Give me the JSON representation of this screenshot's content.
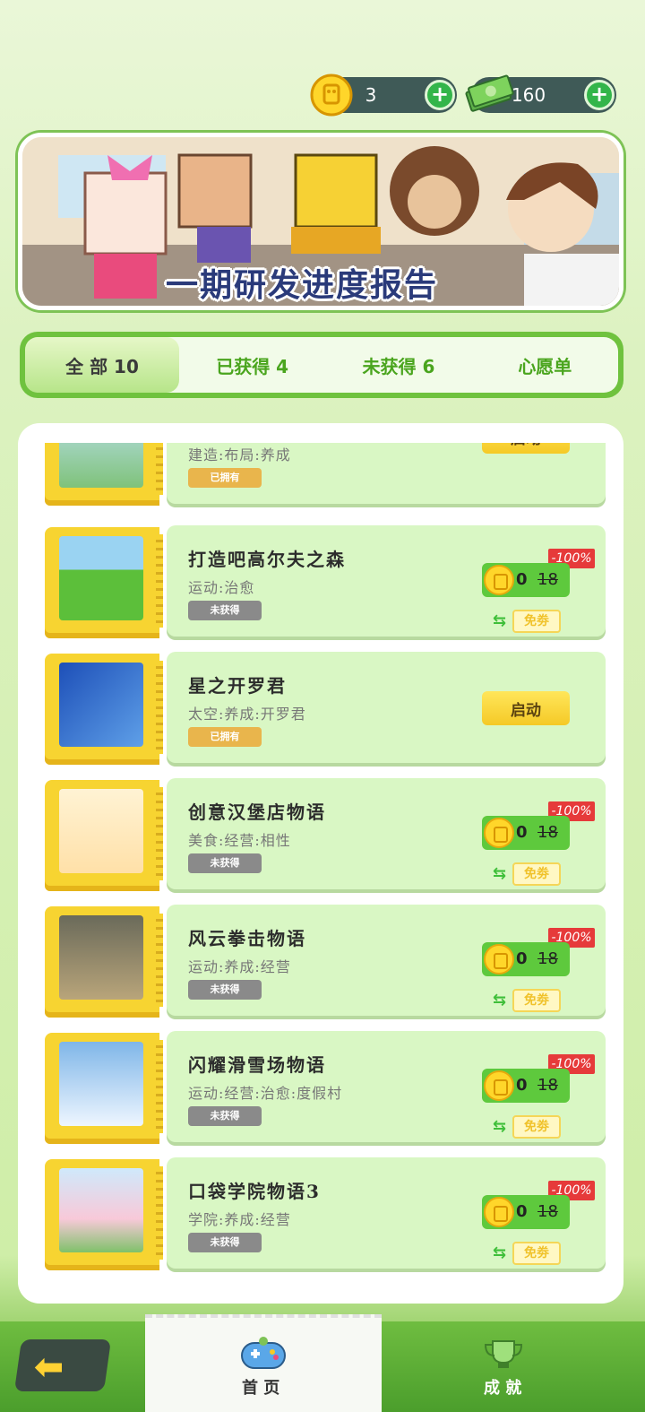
{
  "currency": {
    "coins": "3",
    "cash": "160"
  },
  "banner": {
    "title": "一期研发进度报告"
  },
  "tabs": [
    {
      "label": "全 部 10",
      "active": true
    },
    {
      "label": "已获得 4"
    },
    {
      "label": "未获得 6"
    },
    {
      "label": "心愿单"
    }
  ],
  "games": [
    {
      "title": "",
      "tags": "建造:布局:养成",
      "status": "已拥有",
      "action": "启动",
      "owned": true
    },
    {
      "title": "打造吧高尔夫之森",
      "tags": "运动:治愈",
      "status": "未获得",
      "price_now": "0",
      "price_old": "18",
      "discount": "-100%",
      "free": "免劵",
      "owned": false
    },
    {
      "title": "星之开罗君",
      "tags": "太空:养成:开罗君",
      "status": "已拥有",
      "action": "启动",
      "owned": true
    },
    {
      "title": "创意汉堡店物语",
      "tags": "美食:经营:相性",
      "status": "未获得",
      "price_now": "0",
      "price_old": "18",
      "discount": "-100%",
      "free": "免劵",
      "owned": false
    },
    {
      "title": "风云拳击物语",
      "tags": "运动:养成:经营",
      "status": "未获得",
      "price_now": "0",
      "price_old": "18",
      "discount": "-100%",
      "free": "免劵",
      "owned": false
    },
    {
      "title": "闪耀滑雪场物语",
      "tags": "运动:经营:治愈:度假村",
      "status": "未获得",
      "price_now": "0",
      "price_old": "18",
      "discount": "-100%",
      "free": "免劵",
      "owned": false
    },
    {
      "title": "口袋学院物语3",
      "tags": "学院:养成:经营",
      "status": "未获得",
      "price_now": "0",
      "price_old": "18",
      "discount": "-100%",
      "free": "免劵",
      "owned": false
    }
  ],
  "nav": {
    "home": "首 页",
    "achievements": "成 就"
  },
  "colors": {
    "accent_green": "#6fc23e",
    "card_bg": "#d9f7c4",
    "launch_yellow": "#f5c926",
    "discount_red": "#e63a3a"
  }
}
